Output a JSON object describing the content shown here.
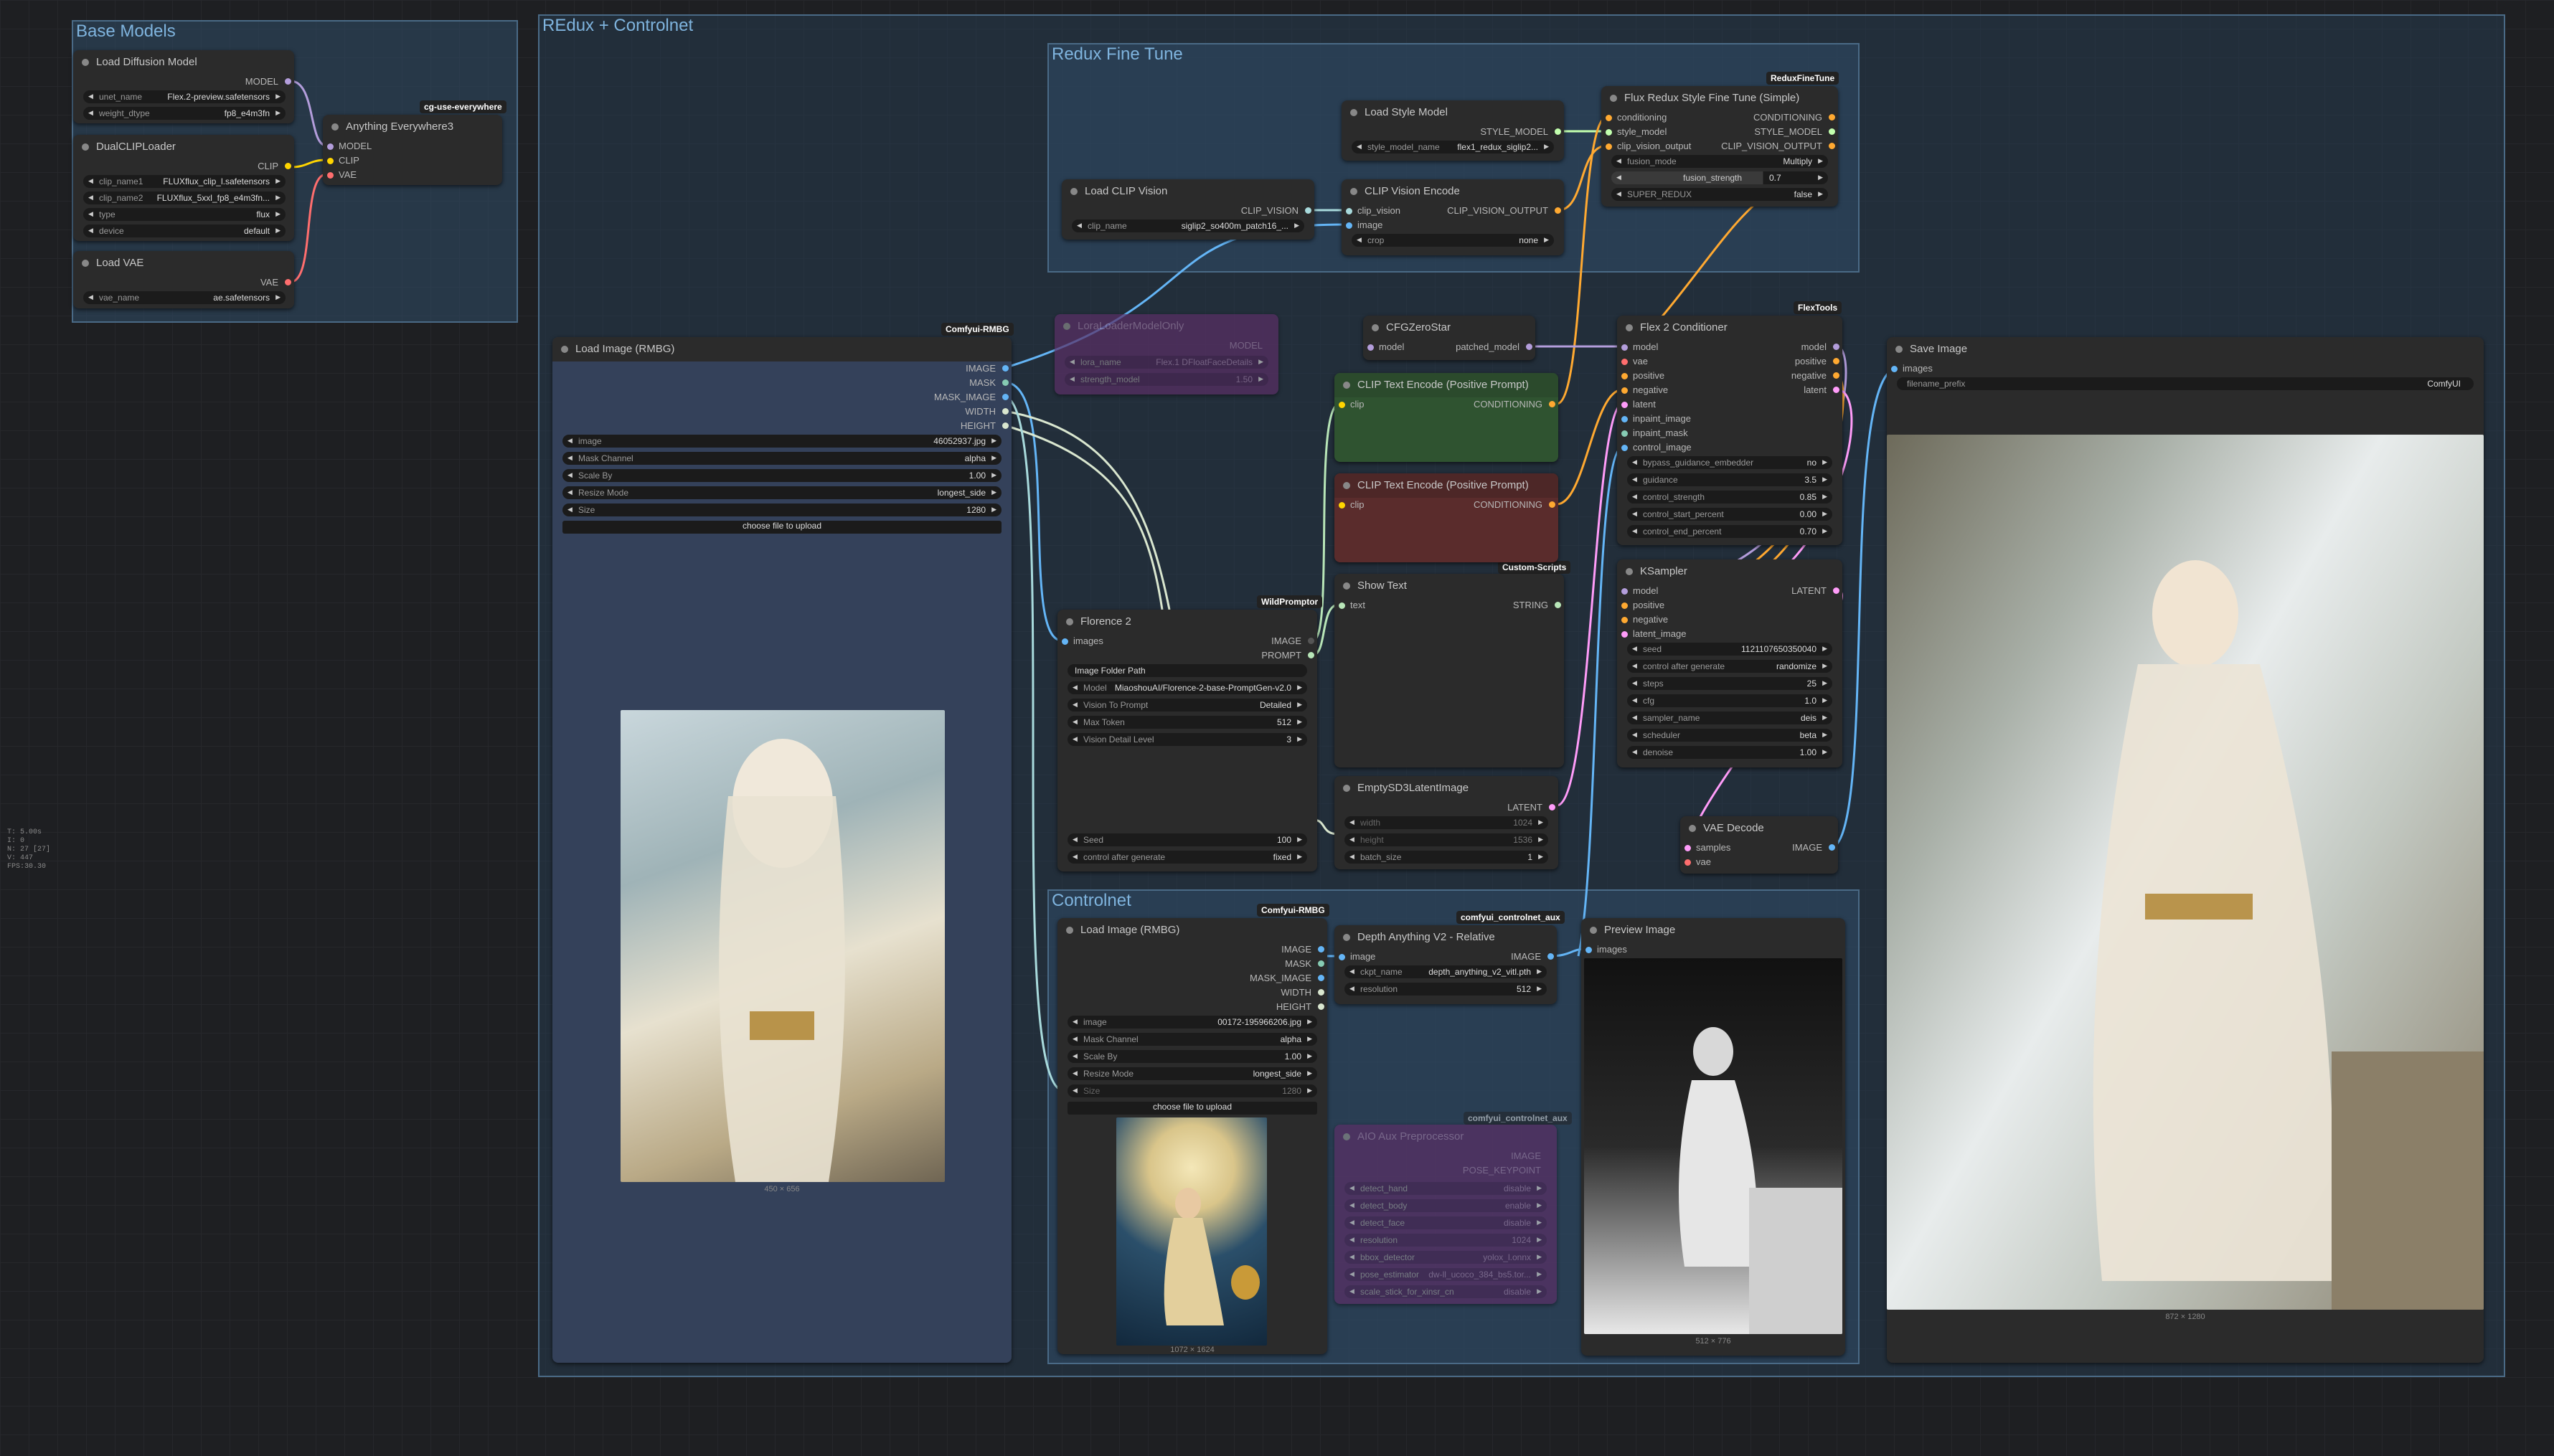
{
  "stats": [
    "T: 5.00s",
    "I: 0",
    "N: 27 [27]",
    "V: 447",
    "FPS:30.30"
  ],
  "groups": {
    "base": "Base Models",
    "redux": "REdux + Controlnet",
    "fine": "Redux Fine Tune",
    "control": "Controlnet"
  },
  "badges": {
    "cg": "cg-use-everywhere",
    "reduxfine": "ReduxFineTune",
    "comfyrmbg1": "Comfyui-RMBG",
    "flextools": "FlexTools",
    "wild": "WildPromptor",
    "custom": "Custom-Scripts",
    "comfyrmbg2": "Comfyui-RMBG",
    "controlaux": "comfyui_controlnet_aux",
    "controlaux2": "comfyui_controlnet_aux"
  },
  "nodes": {
    "diffusion": {
      "title": "Load Diffusion Model",
      "out": "MODEL",
      "w": [
        {
          "l": "unet_name",
          "v": "Flex.2-preview.safetensors"
        },
        {
          "l": "weight_dtype",
          "v": "fp8_e4m3fn"
        }
      ]
    },
    "clip": {
      "title": "DualCLIPLoader",
      "out": "CLIP",
      "w": [
        {
          "l": "clip_name1",
          "v": "FLUXflux_clip_l.safetensors"
        },
        {
          "l": "clip_name2",
          "v": "FLUXflux_5xxl_fp8_e4m3fn..."
        },
        {
          "l": "type",
          "v": "flux"
        },
        {
          "l": "device",
          "v": "default"
        }
      ]
    },
    "vae": {
      "title": "Load VAE",
      "out": "VAE",
      "w": [
        {
          "l": "vae_name",
          "v": "ae.safetensors"
        }
      ]
    },
    "anything": {
      "title": "Anything Everywhere3",
      "in": [
        "MODEL",
        "CLIP",
        "VAE"
      ]
    },
    "loadimg": {
      "title": "Load Image (RMBG)",
      "outs": [
        "IMAGE",
        "MASK",
        "MASK_IMAGE",
        "WIDTH",
        "HEIGHT"
      ],
      "w": [
        {
          "l": "image",
          "v": "46052937.jpg"
        },
        {
          "l": "Mask Channel",
          "v": "alpha"
        },
        {
          "l": "Scale By",
          "v": "1.00"
        },
        {
          "l": "Resize Mode",
          "v": "longest_side"
        },
        {
          "l": "Size",
          "v": "1280"
        }
      ],
      "upload": "choose file to upload",
      "cap": "450 × 656"
    },
    "loadclipv": {
      "title": "Load CLIP Vision",
      "out": "CLIP_VISION",
      "w": [
        {
          "l": "clip_name",
          "v": "siglip2_so400m_patch16_..."
        }
      ]
    },
    "stylemodel": {
      "title": "Load Style Model",
      "out": "STYLE_MODEL",
      "w": [
        {
          "l": "style_model_name",
          "v": "flex1_redux_siglip2..."
        }
      ]
    },
    "clipvenc": {
      "title": "CLIP Vision Encode",
      "in": [
        "clip_vision",
        "image"
      ],
      "out": "CLIP_VISION_OUTPUT",
      "w": [
        {
          "l": "crop",
          "v": "none"
        }
      ]
    },
    "fluxredux": {
      "title": "Flux Redux Style Fine Tune (Simple)",
      "in": [
        "conditioning",
        "style_model",
        "clip_vision_output"
      ],
      "outs": [
        "CONDITIONING",
        "STYLE_MODEL",
        "CLIP_VISION_OUTPUT"
      ],
      "w": [
        {
          "l": "fusion_mode",
          "v": "Multiply"
        },
        {
          "l": "fusion_strength",
          "v": "0.7"
        },
        {
          "l": "SUPER_REDUX",
          "v": "false"
        }
      ]
    },
    "lora": {
      "title": "LoraLoaderModelOnly",
      "out": "MODEL",
      "w": [
        {
          "l": "lora_name",
          "v": "Flex.1 DFloatFaceDetails"
        },
        {
          "l": "strength_model",
          "v": "1.50"
        }
      ]
    },
    "cfgzero": {
      "title": "CFGZeroStar",
      "in": [
        "model"
      ],
      "out": "patched_model"
    },
    "pos1": {
      "title": "CLIP Text Encode (Positive Prompt)",
      "in": [
        "clip"
      ],
      "out": "CONDITIONING"
    },
    "pos2": {
      "title": "CLIP Text Encode (Positive Prompt)",
      "in": [
        "clip"
      ],
      "out": "CONDITIONING"
    },
    "flex2": {
      "title": "Flex 2 Conditioner",
      "in": [
        "model",
        "vae",
        "positive",
        "negative",
        "latent",
        "inpaint_image",
        "inpaint_mask",
        "control_image"
      ],
      "outs": [
        "model",
        "positive",
        "negative",
        "latent"
      ],
      "w": [
        {
          "l": "bypass_guidance_embedder",
          "v": "no"
        },
        {
          "l": "guidance",
          "v": "3.5"
        },
        {
          "l": "control_strength",
          "v": "0.85"
        },
        {
          "l": "control_start_percent",
          "v": "0.00"
        },
        {
          "l": "control_end_percent",
          "v": "0.70"
        }
      ]
    },
    "showtext": {
      "title": "Show Text",
      "in": [
        "text"
      ],
      "out": "STRING"
    },
    "florence": {
      "title": "Florence 2",
      "in": [
        "images"
      ],
      "outs": [
        "IMAGE",
        "PROMPT"
      ],
      "w": [
        {
          "l": "Image Folder Path",
          "v": ""
        },
        {
          "l": "Model",
          "v": "MiaoshouAI/Florence-2-base-PromptGen-v2.0"
        },
        {
          "l": "Vision To Prompt",
          "v": "Detailed"
        },
        {
          "l": "Max Token",
          "v": "512"
        },
        {
          "l": "Vision Detail Level",
          "v": "3"
        }
      ],
      "w2": [
        {
          "l": "Seed",
          "v": "100"
        },
        {
          "l": "control after generate",
          "v": "fixed"
        }
      ]
    },
    "ksampler": {
      "title": "KSampler",
      "in": [
        "model",
        "positive",
        "negative",
        "latent_image"
      ],
      "out": "LATENT",
      "w": [
        {
          "l": "seed",
          "v": "1121107650350040"
        },
        {
          "l": "control after generate",
          "v": "randomize"
        },
        {
          "l": "steps",
          "v": "25"
        },
        {
          "l": "cfg",
          "v": "1.0"
        },
        {
          "l": "sampler_name",
          "v": "deis"
        },
        {
          "l": "scheduler",
          "v": "beta"
        },
        {
          "l": "denoise",
          "v": "1.00"
        }
      ]
    },
    "latent": {
      "title": "EmptySD3LatentImage",
      "out": "LATENT",
      "w": [
        {
          "l": "width",
          "v": "1024"
        },
        {
          "l": "height",
          "v": "1536"
        },
        {
          "l": "batch_size",
          "v": "1"
        }
      ]
    },
    "vaedec": {
      "title": "VAE Decode",
      "in": [
        "samples",
        "vae"
      ],
      "out": "IMAGE"
    },
    "save": {
      "title": "Save Image",
      "in": [
        "images"
      ],
      "w": [
        {
          "l": "filename_prefix",
          "v": "ComfyUI"
        }
      ],
      "cap": "872 × 1280"
    },
    "loadimg2": {
      "title": "Load Image (RMBG)",
      "outs": [
        "IMAGE",
        "MASK",
        "MASK_IMAGE",
        "WIDTH",
        "HEIGHT"
      ],
      "w": [
        {
          "l": "image",
          "v": "00172-195966206.jpg"
        },
        {
          "l": "Mask Channel",
          "v": "alpha"
        },
        {
          "l": "Scale By",
          "v": "1.00"
        },
        {
          "l": "Resize Mode",
          "v": "longest_side"
        },
        {
          "l": "Size",
          "v": "1280"
        }
      ],
      "upload": "choose file to upload",
      "cap": "1072 × 1624"
    },
    "depth": {
      "title": "Depth Anything V2 - Relative",
      "in": [
        "image"
      ],
      "out": "IMAGE",
      "w": [
        {
          "l": "ckpt_name",
          "v": "depth_anything_v2_vitl.pth"
        },
        {
          "l": "resolution",
          "v": "512"
        }
      ]
    },
    "preview": {
      "title": "Preview Image",
      "in": [
        "images"
      ],
      "cap": "512 × 776"
    },
    "canny": {
      "title": "AIO Aux Preprocessor",
      "outs": [
        "IMAGE",
        "POSE_KEYPOINT"
      ],
      "w": [
        {
          "l": "detect_hand",
          "v": "disable"
        },
        {
          "l": "detect_body",
          "v": "enable"
        },
        {
          "l": "detect_face",
          "v": "disable"
        },
        {
          "l": "resolution",
          "v": "1024"
        },
        {
          "l": "bbox_detector",
          "v": "yolox_l.onnx"
        },
        {
          "l": "pose_estimator",
          "v": "dw-ll_ucoco_384_bs5.tor..."
        },
        {
          "l": "scale_stick_for_xinsr_cn",
          "v": "disable"
        }
      ]
    }
  },
  "colors": {
    "model": "#b39ddb",
    "clip": "#ffd500",
    "vae": "#ff6e6e",
    "image": "#64b5f6",
    "cond": "#ffa931",
    "latent": "#ff9cf9",
    "clipv": "#a8dadc",
    "style": "#c2ffae",
    "text": "#b8e6b8"
  }
}
